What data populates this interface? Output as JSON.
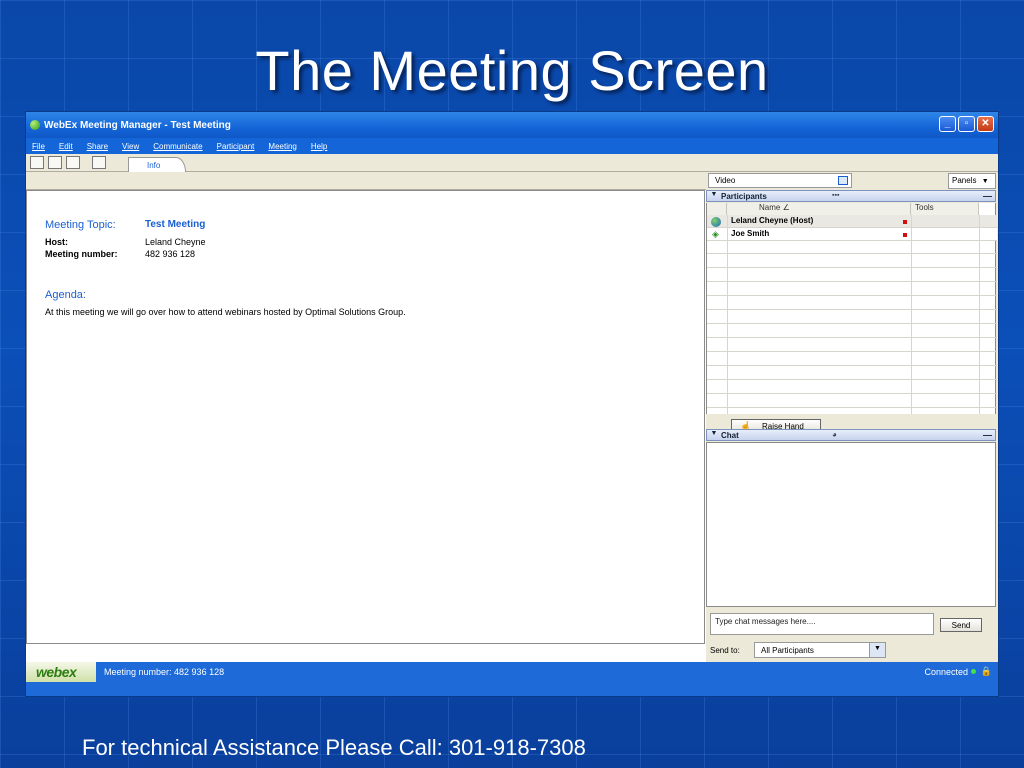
{
  "slide": {
    "title": "The Meeting Screen",
    "footer": "For technical Assistance Please Call: 301-918-7308"
  },
  "window": {
    "title": "WebEx Meeting Manager - Test Meeting",
    "menu": [
      "File",
      "Edit",
      "Share",
      "View",
      "Communicate",
      "Participant",
      "Meeting",
      "Help"
    ],
    "tab": "Info",
    "buttons": {
      "minimize": "_",
      "restore": "▫",
      "close": "✕"
    }
  },
  "info": {
    "topic_label": "Meeting Topic:",
    "topic_value": "Test Meeting",
    "host_label": "Host:",
    "host_value": "Leland Cheyne",
    "number_label": "Meeting number:",
    "number_value": "482 936 128",
    "agenda_label": "Agenda:",
    "agenda_text": "At this meeting we will go over how to attend webinars hosted by Optimal Solutions Group."
  },
  "right_panel": {
    "video_label": "Video",
    "panels_label": "Panels",
    "participants_header": "Participants",
    "col_name": "Name",
    "col_tools": "Tools",
    "participants": [
      {
        "name": "Leland Cheyne (Host)"
      },
      {
        "name": "Joe Smith"
      }
    ],
    "raise_hand": "Raise Hand",
    "chat_header": "Chat",
    "chat_placeholder": "Type chat messages here....",
    "send_label": "Send",
    "send_to_label": "Send to:",
    "send_to_value": "All Participants"
  },
  "status": {
    "brand": "webex",
    "meeting_number": "Meeting number: 482 936 128",
    "connection": "Connected"
  }
}
